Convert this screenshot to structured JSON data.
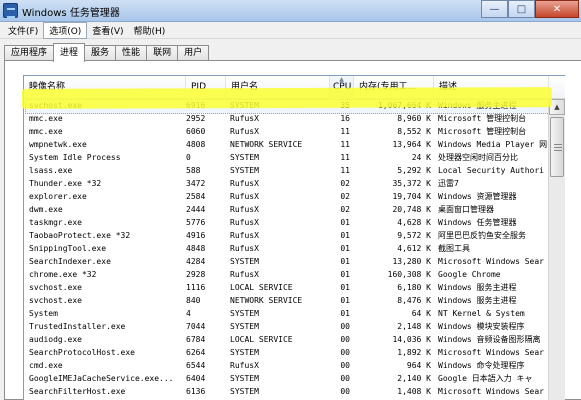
{
  "window": {
    "title": "Windows 任务管理器",
    "min_glyph": "—",
    "max_glyph": "□",
    "close_glyph": "✕"
  },
  "menu": [
    {
      "label": "文件(F)"
    },
    {
      "label": "选项(O)",
      "active": true
    },
    {
      "label": "查看(V)"
    },
    {
      "label": "帮助(H)"
    }
  ],
  "tabs": [
    {
      "label": "应用程序"
    },
    {
      "label": "进程",
      "active": true
    },
    {
      "label": "服务"
    },
    {
      "label": "性能"
    },
    {
      "label": "联网"
    },
    {
      "label": "用户"
    }
  ],
  "columns": {
    "name": "映像名称",
    "pid": "PID",
    "user": "用户名",
    "cpu": "CPU",
    "mem": "内存(专用工...",
    "desc": "描述"
  },
  "sorted_column": "cpu",
  "colors": {
    "highlight": "#faff31",
    "selection_border": "#7ea6d6",
    "close_button": "#c7452a"
  },
  "processes": [
    {
      "name": "svchost.exe",
      "pid": "6916",
      "user": "SYSTEM",
      "cpu": "35",
      "mem": "1,067,664 K",
      "desc": "Windows 服务主进程",
      "selected": true
    },
    {
      "name": "mmc.exe",
      "pid": "2952",
      "user": "RufusX",
      "cpu": "16",
      "mem": "8,960 K",
      "desc": "Microsoft 管理控制台"
    },
    {
      "name": "mmc.exe",
      "pid": "6060",
      "user": "RufusX",
      "cpu": "11",
      "mem": "8,552 K",
      "desc": "Microsoft 管理控制台"
    },
    {
      "name": "wmpnetwk.exe",
      "pid": "4808",
      "user": "NETWORK SERVICE",
      "cpu": "11",
      "mem": "13,964 K",
      "desc": "Windows Media Player 网"
    },
    {
      "name": "System Idle Process",
      "pid": "0",
      "user": "SYSTEM",
      "cpu": "11",
      "mem": "24 K",
      "desc": "处理器空闲时间百分比"
    },
    {
      "name": "lsass.exe",
      "pid": "588",
      "user": "SYSTEM",
      "cpu": "11",
      "mem": "5,292 K",
      "desc": "Local Security Authori"
    },
    {
      "name": "Thunder.exe *32",
      "pid": "3472",
      "user": "RufusX",
      "cpu": "02",
      "mem": "35,372 K",
      "desc": "迅雷7"
    },
    {
      "name": "explorer.exe",
      "pid": "2584",
      "user": "RufusX",
      "cpu": "02",
      "mem": "19,704 K",
      "desc": "Windows 资源管理器"
    },
    {
      "name": "dwm.exe",
      "pid": "2444",
      "user": "RufusX",
      "cpu": "02",
      "mem": "20,748 K",
      "desc": "桌面窗口管理器"
    },
    {
      "name": "taskmgr.exe",
      "pid": "5776",
      "user": "RufusX",
      "cpu": "01",
      "mem": "4,628 K",
      "desc": "Windows 任务管理器"
    },
    {
      "name": "TaobaoProtect.exe *32",
      "pid": "4916",
      "user": "RufusX",
      "cpu": "01",
      "mem": "9,572 K",
      "desc": "阿里巴巴反钓鱼安全服务"
    },
    {
      "name": "SnippingTool.exe",
      "pid": "4848",
      "user": "RufusX",
      "cpu": "01",
      "mem": "4,612 K",
      "desc": "截图工具"
    },
    {
      "name": "SearchIndexer.exe",
      "pid": "4284",
      "user": "SYSTEM",
      "cpu": "01",
      "mem": "13,280 K",
      "desc": "Microsoft Windows Sear"
    },
    {
      "name": "chrome.exe *32",
      "pid": "2928",
      "user": "RufusX",
      "cpu": "01",
      "mem": "160,308 K",
      "desc": "Google Chrome"
    },
    {
      "name": "svchost.exe",
      "pid": "1116",
      "user": "LOCAL SERVICE",
      "cpu": "01",
      "mem": "6,180 K",
      "desc": "Windows 服务主进程"
    },
    {
      "name": "svchost.exe",
      "pid": "840",
      "user": "NETWORK SERVICE",
      "cpu": "01",
      "mem": "8,476 K",
      "desc": "Windows 服务主进程"
    },
    {
      "name": "System",
      "pid": "4",
      "user": "SYSTEM",
      "cpu": "01",
      "mem": "64 K",
      "desc": "NT Kernel & System"
    },
    {
      "name": "TrustedInstaller.exe",
      "pid": "7044",
      "user": "SYSTEM",
      "cpu": "00",
      "mem": "2,148 K",
      "desc": "Windows 模块安装程序"
    },
    {
      "name": "audiodg.exe",
      "pid": "6784",
      "user": "LOCAL SERVICE",
      "cpu": "00",
      "mem": "14,036 K",
      "desc": "Windows 音频设备图形隔离"
    },
    {
      "name": "SearchProtocolHost.exe",
      "pid": "6264",
      "user": "SYSTEM",
      "cpu": "00",
      "mem": "1,892 K",
      "desc": "Microsoft Windows Sear"
    },
    {
      "name": "cmd.exe",
      "pid": "6544",
      "user": "RufusX",
      "cpu": "00",
      "mem": "964 K",
      "desc": "Windows 命令处理程序"
    },
    {
      "name": "GoogleIMEJaCacheService.exe...",
      "pid": "6404",
      "user": "SYSTEM",
      "cpu": "00",
      "mem": "2,140 K",
      "desc": "Google 日本語入力 キャ"
    },
    {
      "name": "SearchFilterHost.exe",
      "pid": "6136",
      "user": "SYSTEM",
      "cpu": "00",
      "mem": "1,408 K",
      "desc": "Microsoft Windows Sear"
    }
  ]
}
